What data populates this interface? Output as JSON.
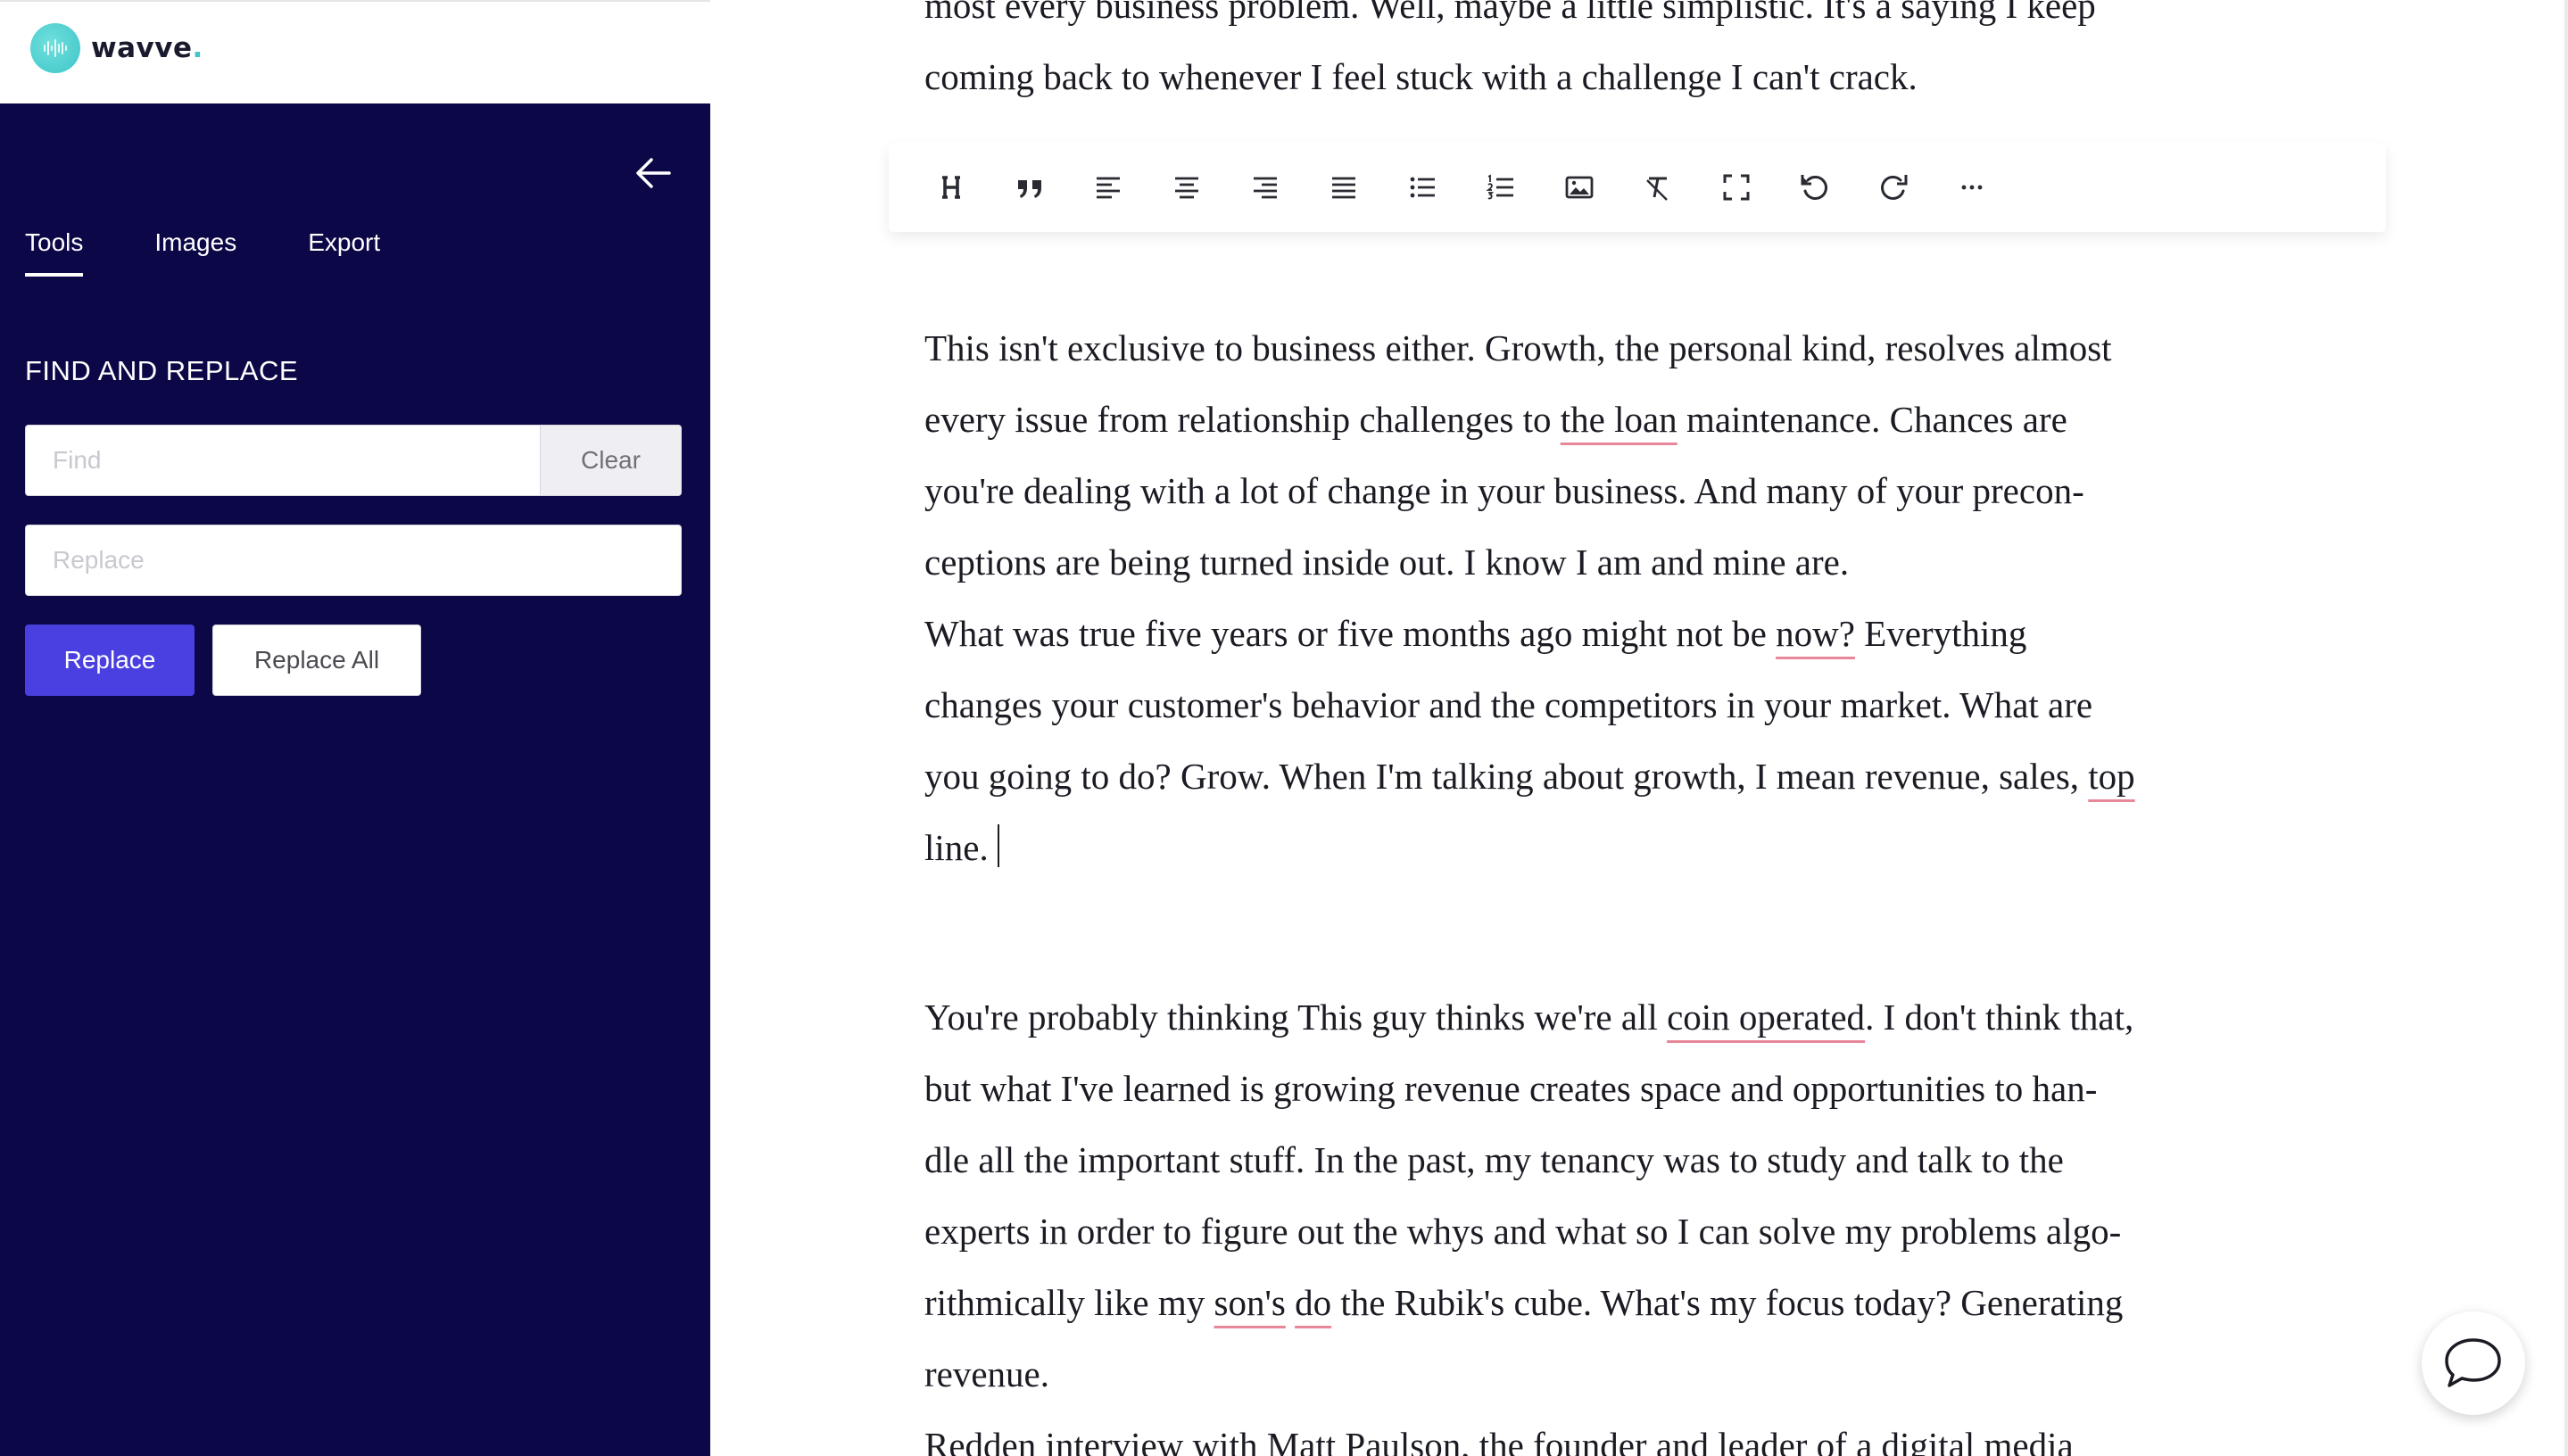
{
  "brand": {
    "name": "wavve",
    "dot": ".",
    "accent": "#3fc4c9"
  },
  "sidebar": {
    "background": "#0c0746",
    "tabs": [
      {
        "label": "Tools",
        "active": true
      },
      {
        "label": "Images",
        "active": false
      },
      {
        "label": "Export",
        "active": false
      }
    ],
    "find_replace": {
      "title": "FIND AND REPLACE",
      "find_placeholder": "Find",
      "find_value": "",
      "clear_label": "Clear",
      "replace_placeholder": "Replace",
      "replace_value": "",
      "replace_label": "Replace",
      "replace_all_label": "Replace All"
    },
    "primary_button_color": "#4a3fe0"
  },
  "toolbar": {
    "icons": [
      "heading-icon",
      "quote-icon",
      "align-left-icon",
      "align-center-icon",
      "align-right-icon",
      "align-justify-icon",
      "bulleted-list-icon",
      "numbered-list-icon",
      "image-icon",
      "clear-formatting-icon",
      "fullscreen-icon",
      "undo-icon",
      "redo-icon",
      "more-icon"
    ]
  },
  "editor": {
    "p_top": {
      "l1": "most every business problem. Well, maybe a little simplistic. It's a saying I keep",
      "l2": "coming back to whenever I feel stuck with a challenge I can't crack."
    },
    "p_growth": {
      "l1": "This isn't exclusive to business either. Growth, the personal kind, resolves almost",
      "l2a": "every issue from relationship challenges to ",
      "l2m": "the loan",
      "l2b": " maintenance. Chances are",
      "l3": "you're dealing with a lot of change in your business. And many of your precon-",
      "l4": "ceptions are being turned inside out. I know I am and mine are.",
      "l5a": "What was true five years or five months ago might not be ",
      "l5m": "now?",
      "l5b": " Everything",
      "l6": "changes your customer's behavior and the competitors in your market. What are",
      "l7a": "you going to do? Grow. When I'm talking about growth, I mean revenue, sales, ",
      "l7m": "top",
      "l8": "line."
    },
    "p_coin": {
      "l1a": "You're probably thinking This guy thinks we're all ",
      "l1m": "coin operated",
      "l1b": ". I don't think that,",
      "l2": "but what I've learned is growing revenue creates space and opportunities to han-",
      "l3": "dle all the important stuff. In the past, my tenancy was to study and talk to the",
      "l4": "experts in order to figure out the whys and what so I can solve my problems algo-",
      "l5a": "rithmically like my ",
      "l5m1": "son's",
      "l5s": " ",
      "l5m2": "do",
      "l5b": " the Rubik's cube. What's my focus today? Generating",
      "l6": "revenue."
    },
    "p_last": {
      "l1": "Redden interview with Matt Paulson, the founder and leader of a digital media"
    },
    "underline_color": "#e8869a"
  },
  "chat": {
    "icon": "chat-bubble-icon"
  }
}
